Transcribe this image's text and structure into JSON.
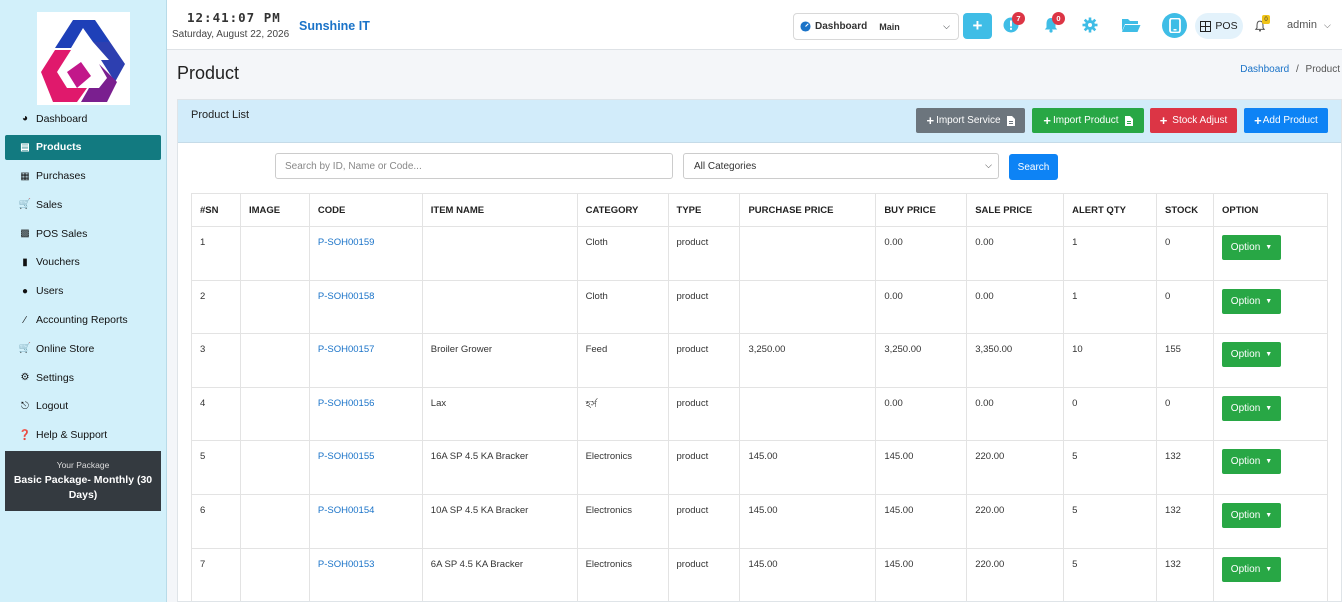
{
  "header": {
    "time": "12:41:07 PM",
    "date": "Saturday, August 22, 2026",
    "brand": "Sunshine IT",
    "dashboard_label": "Dashboard",
    "dashboard_value": "Main",
    "notif_badge_1": "7",
    "notif_badge_2": "0",
    "pos_label": "POS",
    "small_badge": "0",
    "user": "admin"
  },
  "sidebar": {
    "items": [
      {
        "label": "Dashboard",
        "icon": "dashboard-icon"
      },
      {
        "label": "Products",
        "icon": "products-icon",
        "active": true
      },
      {
        "label": "Purchases",
        "icon": "purchases-icon"
      },
      {
        "label": "Sales",
        "icon": "cart-icon"
      },
      {
        "label": "POS Sales",
        "icon": "pos-icon"
      },
      {
        "label": "Vouchers",
        "icon": "voucher-icon"
      },
      {
        "label": "Users",
        "icon": "users-icon"
      },
      {
        "label": "Accounting Reports",
        "icon": "chart-icon"
      },
      {
        "label": "Online Store",
        "icon": "store-icon"
      },
      {
        "label": "Settings",
        "icon": "gears-icon"
      },
      {
        "label": "Logout",
        "icon": "logout-icon"
      },
      {
        "label": "Help & Support",
        "icon": "help-icon"
      }
    ],
    "package_caption": "Your Package",
    "package_name": "Basic Package- Monthly (30 Days)"
  },
  "page": {
    "title": "Product",
    "breadcrumb_home": "Dashboard",
    "breadcrumb_sep": "/",
    "breadcrumb_current": "Product"
  },
  "card": {
    "title": "Product List",
    "buttons": {
      "import_service": "Import Service",
      "import_product": "Import Product",
      "stock_adjust": "Stock Adjust",
      "add_product": "Add Product"
    },
    "search_placeholder": "Search by ID, Name or Code...",
    "category_value": "All Categories",
    "search_button": "Search"
  },
  "table": {
    "columns": [
      "#SN",
      "IMAGE",
      "CODE",
      "ITEM NAME",
      "CATEGORY",
      "TYPE",
      "PURCHASE PRICE",
      "BUY PRICE",
      "SALE PRICE",
      "ALERT QTY",
      "STOCK",
      "OPTION"
    ],
    "option_label": "Option",
    "rows": [
      {
        "sn": "1",
        "code": "P-SOH00159",
        "name": "",
        "category": "Cloth",
        "type": "product",
        "purchase": "",
        "buy": "0.00",
        "sale": "0.00",
        "alert": "1",
        "stock": "0"
      },
      {
        "sn": "2",
        "code": "P-SOH00158",
        "name": "",
        "category": "Cloth",
        "type": "product",
        "purchase": "",
        "buy": "0.00",
        "sale": "0.00",
        "alert": "1",
        "stock": "0"
      },
      {
        "sn": "3",
        "code": "P-SOH00157",
        "name": "Broiler Grower",
        "category": "Feed",
        "type": "product",
        "purchase": "3,250.00",
        "buy": "3,250.00",
        "sale": "3,350.00",
        "alert": "10",
        "stock": "155"
      },
      {
        "sn": "4",
        "code": "P-SOH00156",
        "name": "Lax",
        "category": "হর্স",
        "type": "product",
        "purchase": "",
        "buy": "0.00",
        "sale": "0.00",
        "alert": "0",
        "stock": "0"
      },
      {
        "sn": "5",
        "code": "P-SOH00155",
        "name": "16A SP 4.5 KA Bracker",
        "category": "Electronics",
        "type": "product",
        "purchase": "145.00",
        "buy": "145.00",
        "sale": "220.00",
        "alert": "5",
        "stock": "132"
      },
      {
        "sn": "6",
        "code": "P-SOH00154",
        "name": "10A SP 4.5 KA Bracker",
        "category": "Electronics",
        "type": "product",
        "purchase": "145.00",
        "buy": "145.00",
        "sale": "220.00",
        "alert": "5",
        "stock": "132"
      },
      {
        "sn": "7",
        "code": "P-SOH00153",
        "name": "6A SP 4.5 KA Bracker",
        "category": "Electronics",
        "type": "product",
        "purchase": "145.00",
        "buy": "145.00",
        "sale": "220.00",
        "alert": "5",
        "stock": "132"
      }
    ]
  },
  "colors": {
    "sidebar_bg": "#d2f0fa",
    "active_nav": "#127a80",
    "primary": "#0d83f5",
    "success": "#28a745",
    "danger": "#dc3545",
    "secondary": "#6c757d"
  }
}
